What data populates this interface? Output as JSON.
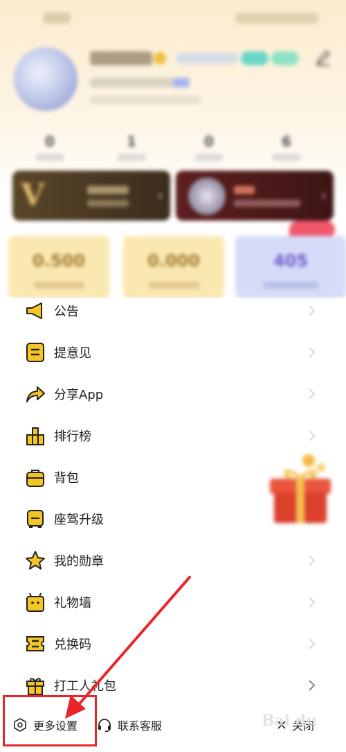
{
  "stats": [
    "0",
    "1",
    "0",
    "6"
  ],
  "coins": [
    {
      "value": "0.500"
    },
    {
      "value": "0.000"
    },
    {
      "value": "405"
    }
  ],
  "vip_card": {
    "symbol": "V"
  },
  "menu": {
    "items": [
      {
        "label": "公告",
        "icon": "megaphone-icon"
      },
      {
        "label": "提意见",
        "icon": "feedback-icon"
      },
      {
        "label": "分享App",
        "icon": "share-icon"
      },
      {
        "label": "排行榜",
        "icon": "ranking-icon"
      },
      {
        "label": "背包",
        "icon": "backpack-icon"
      },
      {
        "label": "座驾升级",
        "icon": "vehicle-icon"
      },
      {
        "label": "我的勋章",
        "icon": "star-icon"
      },
      {
        "label": "礼物墙",
        "icon": "gift-wall-icon"
      },
      {
        "label": "兑换码",
        "icon": "redeem-icon"
      },
      {
        "label": "打工人礼包",
        "icon": "gift-pack-icon"
      }
    ]
  },
  "bottom_bar": {
    "settings_label": "更多设置",
    "service_label": "联系客服",
    "close_label": "关闭"
  },
  "colors": {
    "accent_yellow": "#f5c623",
    "annotation_red": "#e8262a"
  }
}
